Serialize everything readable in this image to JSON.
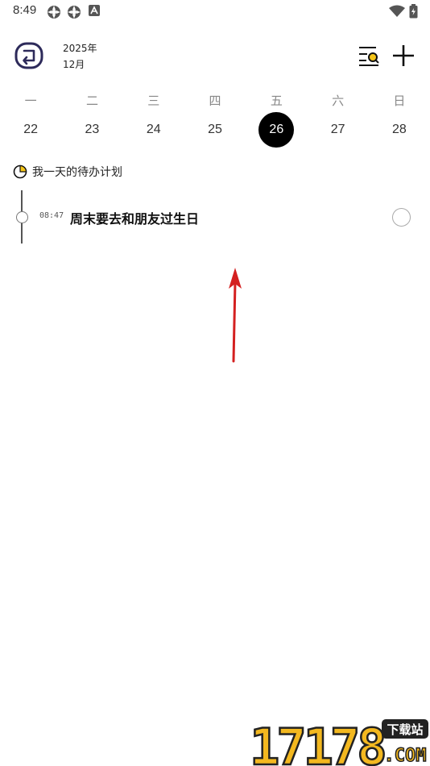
{
  "status_bar": {
    "time": "8:49"
  },
  "header": {
    "year": "2025年",
    "month": "12月"
  },
  "week": {
    "weekdays": [
      "一",
      "二",
      "三",
      "四",
      "五",
      "六",
      "日"
    ],
    "dates": [
      "22",
      "23",
      "24",
      "25",
      "26",
      "27",
      "28"
    ],
    "selected_index": 4
  },
  "plan": {
    "title": "我一天的待办计划",
    "tasks": [
      {
        "time": "08:47",
        "title": "周末要去和朋友过生日",
        "done": false
      }
    ]
  },
  "watermark": {
    "text": "17178",
    "badge": "下载站",
    "suffix": ".COM"
  },
  "colors": {
    "selected_date_bg": "#000000",
    "accent_yellow": "#f5c518",
    "logo_purple": "#2d2a5a",
    "arrow_red": "#d42020"
  }
}
